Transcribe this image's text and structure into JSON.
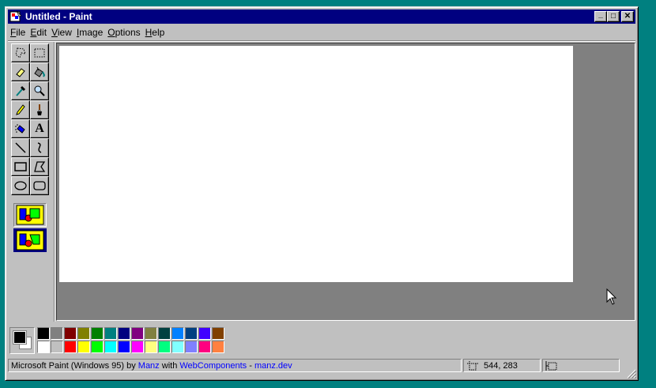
{
  "window": {
    "title": "Untitled - Paint",
    "controls": {
      "minimize": "_",
      "maximize": "□",
      "close": "✕"
    }
  },
  "menu": [
    {
      "accel": "F",
      "rest": "ile"
    },
    {
      "accel": "E",
      "rest": "dit"
    },
    {
      "accel": "V",
      "rest": "iew"
    },
    {
      "accel": "I",
      "rest": "mage"
    },
    {
      "accel": "O",
      "rest": "ptions"
    },
    {
      "accel": "H",
      "rest": "elp"
    }
  ],
  "tools": [
    "free-form-select-icon",
    "rect-select-icon",
    "eraser-icon",
    "fill-bucket-icon",
    "color-picker-icon",
    "magnifier-icon",
    "pencil-icon",
    "brush-icon",
    "airbrush-icon",
    "text-icon",
    "line-icon",
    "curve-icon",
    "rectangle-icon",
    "polygon-icon",
    "ellipse-icon",
    "rounded-rect-icon"
  ],
  "text_tool_glyph": "A",
  "colors": {
    "primary": "#000000",
    "secondary": "#ffffff",
    "palette_row1": [
      "#000000",
      "#808080",
      "#800000",
      "#808000",
      "#008000",
      "#008080",
      "#000080",
      "#800080",
      "#808040",
      "#004040",
      "#0080ff",
      "#004080",
      "#4000ff",
      "#804000"
    ],
    "palette_row2": [
      "#ffffff",
      "#c0c0c0",
      "#ff0000",
      "#ffff00",
      "#00ff00",
      "#00ffff",
      "#0000ff",
      "#ff00ff",
      "#ffff80",
      "#00ff80",
      "#80ffff",
      "#8080ff",
      "#ff0080",
      "#ff8040"
    ]
  },
  "status": {
    "prefix": "Microsoft Paint (Windows 95) by ",
    "author": "Manz",
    "with": " with ",
    "tech": "WebComponents",
    "dash": " - ",
    "site": "manz.dev",
    "coords": "544, 283",
    "size": ""
  }
}
